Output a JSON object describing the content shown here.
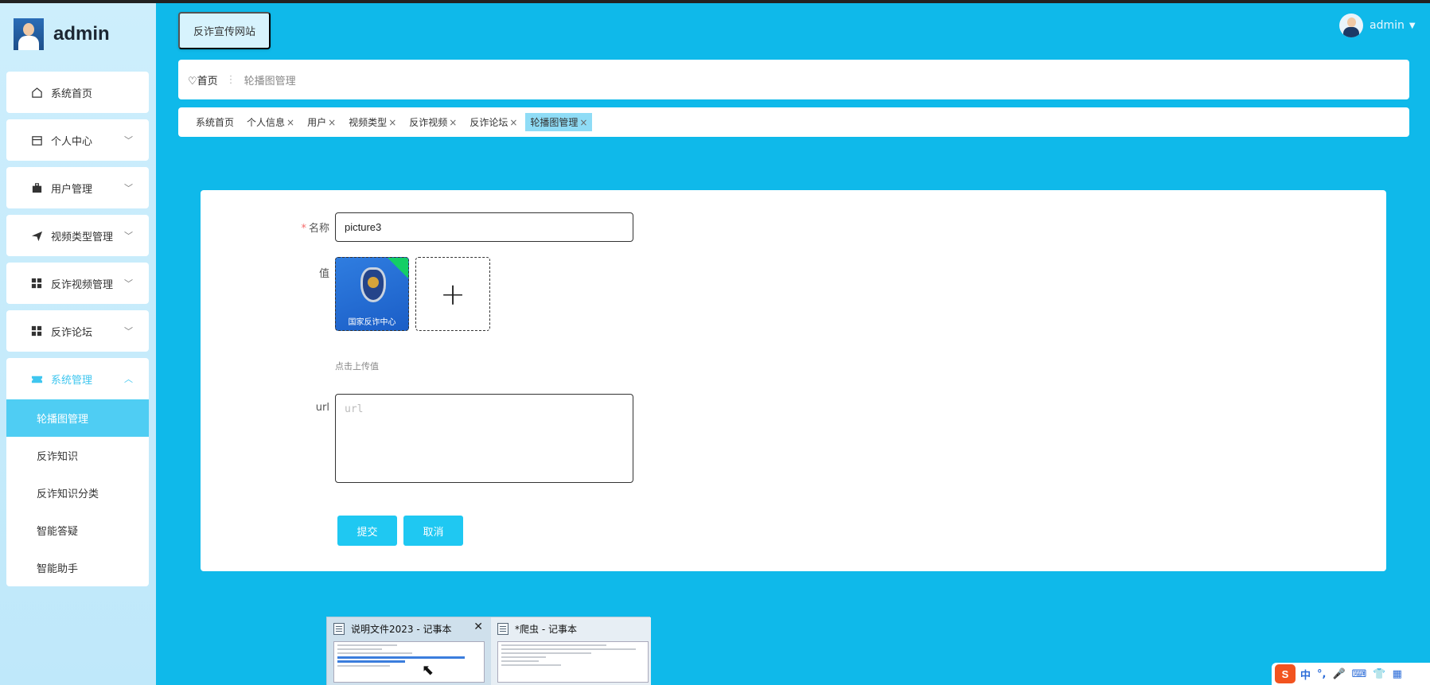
{
  "brand": {
    "title": "admin"
  },
  "header": {
    "site_button": "反诈宣传网站",
    "user_name": "admin"
  },
  "sidebar": {
    "items": [
      {
        "label": "系统首页",
        "icon": "home-icon"
      },
      {
        "label": "个人中心",
        "icon": "calendar-icon"
      },
      {
        "label": "用户管理",
        "icon": "briefcase-icon"
      },
      {
        "label": "视频类型管理",
        "icon": "send-icon"
      },
      {
        "label": "反诈视频管理",
        "icon": "grid-icon"
      },
      {
        "label": "反诈论坛",
        "icon": "grid-icon"
      },
      {
        "label": "系统管理",
        "icon": "ticket-icon"
      }
    ],
    "subitems": [
      "轮播图管理",
      "反诈知识",
      "反诈知识分类",
      "智能答疑",
      "智能助手"
    ]
  },
  "breadcrumb": {
    "home": "首页",
    "current": "轮播图管理"
  },
  "tabs": [
    {
      "label": "系统首页",
      "closable": false
    },
    {
      "label": "个人信息",
      "closable": true
    },
    {
      "label": "用户",
      "closable": true
    },
    {
      "label": "视频类型",
      "closable": true
    },
    {
      "label": "反诈视频",
      "closable": true
    },
    {
      "label": "反诈论坛",
      "closable": true
    },
    {
      "label": "轮播图管理",
      "closable": true
    }
  ],
  "form": {
    "name_label": "名称",
    "name_value": "picture3",
    "value_label": "值",
    "image_text": "国家反诈中心",
    "upload_hint": "点击上传值",
    "url_label": "url",
    "url_placeholder": "url",
    "submit_label": "提交",
    "cancel_label": "取消"
  },
  "taskbar_preview": {
    "left_title": "说明文件2023 - 记事本",
    "right_title": "*爬虫 - 记事本"
  },
  "ime": {
    "logo": "S",
    "mode": "中",
    "punct": "°,"
  },
  "colors": {
    "accent": "#1fc8f2",
    "page_bg": "#0fb9ea",
    "required": "#f56c6c"
  }
}
